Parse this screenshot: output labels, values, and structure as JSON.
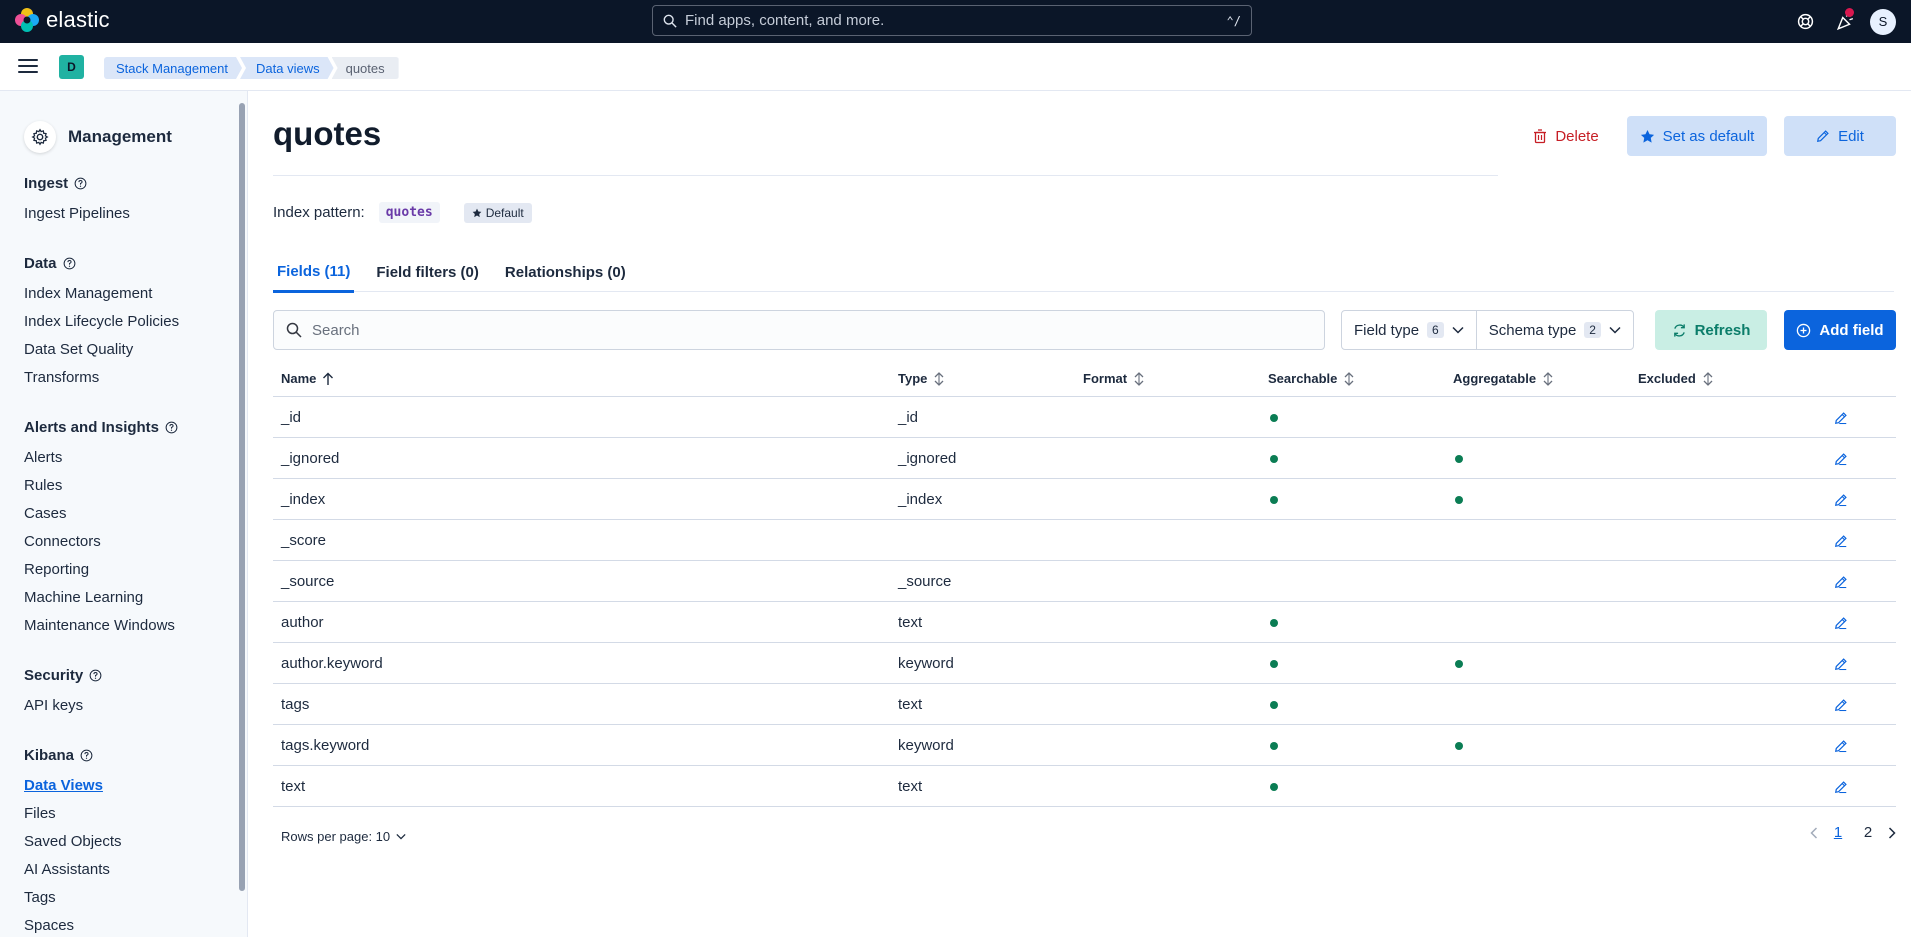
{
  "header": {
    "brand": "elastic",
    "search_placeholder": "Find apps, content, and more.",
    "search_shortcut": "⌃/",
    "avatar_initial": "S"
  },
  "breadcrumbs": {
    "space_initial": "D",
    "items": [
      "Stack Management",
      "Data views",
      "quotes"
    ]
  },
  "sidebar": {
    "title": "Management",
    "groups": [
      {
        "title": "Ingest",
        "items": [
          "Ingest Pipelines"
        ]
      },
      {
        "title": "Data",
        "items": [
          "Index Management",
          "Index Lifecycle Policies",
          "Data Set Quality",
          "Transforms"
        ]
      },
      {
        "title": "Alerts and Insights",
        "items": [
          "Alerts",
          "Rules",
          "Cases",
          "Connectors",
          "Reporting",
          "Machine Learning",
          "Maintenance Windows"
        ]
      },
      {
        "title": "Security",
        "items": [
          "API keys"
        ]
      },
      {
        "title": "Kibana",
        "items": [
          "Data Views",
          "Files",
          "Saved Objects",
          "AI Assistants",
          "Tags",
          "Spaces"
        ]
      }
    ],
    "active_item": "Data Views"
  },
  "page": {
    "title": "quotes",
    "delete_label": "Delete",
    "set_default_label": "Set as default",
    "edit_label": "Edit",
    "index_pattern_label": "Index pattern:",
    "index_pattern_value": "quotes",
    "default_badge": "Default"
  },
  "tabs": [
    "Fields (11)",
    "Field filters (0)",
    "Relationships (0)"
  ],
  "toolbar": {
    "search_placeholder": "Search",
    "field_type_label": "Field type",
    "field_type_count": "6",
    "schema_type_label": "Schema type",
    "schema_type_count": "2",
    "refresh_label": "Refresh",
    "add_field_label": "Add field"
  },
  "table": {
    "columns": [
      "Name",
      "Type",
      "Format",
      "Searchable",
      "Aggregatable",
      "Excluded"
    ],
    "rows": [
      {
        "name": "_id",
        "type": "_id",
        "format": "",
        "searchable": true,
        "aggregatable": false,
        "excluded": false
      },
      {
        "name": "_ignored",
        "type": "_ignored",
        "format": "",
        "searchable": true,
        "aggregatable": true,
        "excluded": false
      },
      {
        "name": "_index",
        "type": "_index",
        "format": "",
        "searchable": true,
        "aggregatable": true,
        "excluded": false
      },
      {
        "name": "_score",
        "type": "",
        "format": "",
        "searchable": false,
        "aggregatable": false,
        "excluded": false
      },
      {
        "name": "_source",
        "type": "_source",
        "format": "",
        "searchable": false,
        "aggregatable": false,
        "excluded": false
      },
      {
        "name": "author",
        "type": "text",
        "format": "",
        "searchable": true,
        "aggregatable": false,
        "excluded": false
      },
      {
        "name": "author.keyword",
        "type": "keyword",
        "format": "",
        "searchable": true,
        "aggregatable": true,
        "excluded": false
      },
      {
        "name": "tags",
        "type": "text",
        "format": "",
        "searchable": true,
        "aggregatable": false,
        "excluded": false
      },
      {
        "name": "tags.keyword",
        "type": "keyword",
        "format": "",
        "searchable": true,
        "aggregatable": true,
        "excluded": false
      },
      {
        "name": "text",
        "type": "text",
        "format": "",
        "searchable": true,
        "aggregatable": false,
        "excluded": false
      }
    ]
  },
  "pagination": {
    "rows_per_page_label": "Rows per page: 10",
    "pages": [
      "1",
      "2"
    ],
    "current_page": "1"
  },
  "colors": {
    "header_bg": "#0b1628",
    "accent": "#0b64dd",
    "danger": "#c61e25",
    "success_dot": "#0b7d54"
  }
}
